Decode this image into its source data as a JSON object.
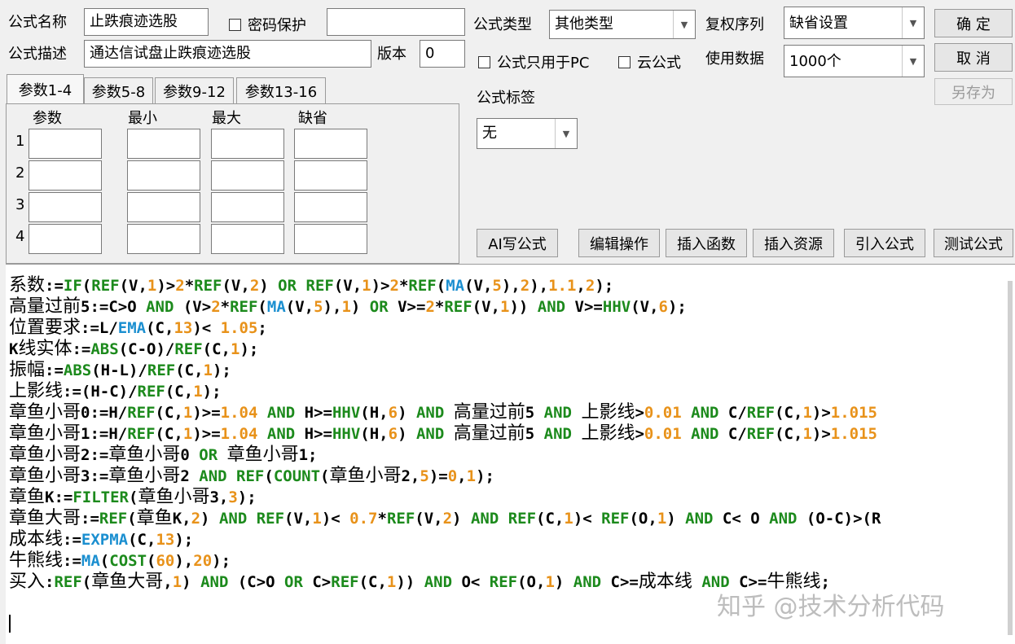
{
  "header": {
    "formula_name_label": "公式名称",
    "formula_name_value": "止跌痕迹选股",
    "password_label": "密码保护",
    "password_value": "",
    "formula_desc_label": "公式描述",
    "formula_desc_value": "通达信试盘止跌痕迹选股",
    "version_label": "版本",
    "version_value": "0",
    "formula_type_label": "公式类型",
    "formula_type_value": "其他类型",
    "adjust_label": "复权序列",
    "adjust_value": "缺省设置",
    "pc_only_label": "公式只用于PC",
    "cloud_label": "云公式",
    "data_label": "使用数据",
    "data_value": "1000个",
    "tag_label": "公式标签",
    "tag_value": "无"
  },
  "buttons": {
    "ok": "确  定",
    "cancel": "取  消",
    "save_as": "另存为",
    "ai_write": "AI写公式",
    "edit_ops": "编辑操作",
    "insert_func": "插入函数",
    "insert_res": "插入资源",
    "import_formula": "引入公式",
    "test_formula": "测试公式"
  },
  "tabs": [
    "参数1-4",
    "参数5-8",
    "参数9-12",
    "参数13-16"
  ],
  "params": {
    "headers": [
      "参数",
      "最小",
      "最大",
      "缺省"
    ],
    "rows": [
      "1",
      "2",
      "3",
      "4"
    ]
  },
  "code_lines": [
    [
      [
        "cn",
        "系数"
      ],
      [
        "op",
        ":="
      ],
      [
        "kw",
        "IF"
      ],
      [
        "op",
        "("
      ],
      [
        "kw",
        "REF"
      ],
      [
        "op",
        "(V,"
      ],
      [
        "num",
        "1"
      ],
      [
        "op",
        ")>"
      ],
      [
        "num",
        "2"
      ],
      [
        "op",
        "*"
      ],
      [
        "kw",
        "REF"
      ],
      [
        "op",
        "(V,"
      ],
      [
        "num",
        "2"
      ],
      [
        "op",
        ") "
      ],
      [
        "kw",
        "OR"
      ],
      [
        "op",
        " "
      ],
      [
        "kw",
        "REF"
      ],
      [
        "op",
        "(V,"
      ],
      [
        "num",
        "1"
      ],
      [
        "op",
        ")>"
      ],
      [
        "num",
        "2"
      ],
      [
        "op",
        "*"
      ],
      [
        "kw",
        "REF"
      ],
      [
        "op",
        "("
      ],
      [
        "blue",
        "MA"
      ],
      [
        "op",
        "(V,"
      ],
      [
        "num",
        "5"
      ],
      [
        "op",
        "),"
      ],
      [
        "num",
        "2"
      ],
      [
        "op",
        "),"
      ],
      [
        "num",
        "1.1"
      ],
      [
        "op",
        ","
      ],
      [
        "num",
        "2"
      ],
      [
        "op",
        ");"
      ]
    ],
    [
      [
        "cn",
        "高量过前"
      ],
      [
        "op",
        "5:=C>O "
      ],
      [
        "kw",
        "AND"
      ],
      [
        "op",
        " (V>"
      ],
      [
        "num",
        "2"
      ],
      [
        "op",
        "*"
      ],
      [
        "kw",
        "REF"
      ],
      [
        "op",
        "("
      ],
      [
        "blue",
        "MA"
      ],
      [
        "op",
        "(V,"
      ],
      [
        "num",
        "5"
      ],
      [
        "op",
        "),"
      ],
      [
        "num",
        "1"
      ],
      [
        "op",
        ") "
      ],
      [
        "kw",
        "OR"
      ],
      [
        "op",
        " V>="
      ],
      [
        "num",
        "2"
      ],
      [
        "op",
        "*"
      ],
      [
        "kw",
        "REF"
      ],
      [
        "op",
        "(V,"
      ],
      [
        "num",
        "1"
      ],
      [
        "op",
        ")) "
      ],
      [
        "kw",
        "AND"
      ],
      [
        "op",
        " V>="
      ],
      [
        "kw",
        "HHV"
      ],
      [
        "op",
        "(V,"
      ],
      [
        "num",
        "6"
      ],
      [
        "op",
        ");"
      ]
    ],
    [
      [
        "cn",
        "位置要求"
      ],
      [
        "op",
        ":=L/"
      ],
      [
        "blue",
        "EMA"
      ],
      [
        "op",
        "(C,"
      ],
      [
        "num",
        "13"
      ],
      [
        "op",
        ")< "
      ],
      [
        "num",
        "1.05"
      ],
      [
        "op",
        ";"
      ]
    ],
    [
      [
        "op",
        "K"
      ],
      [
        "cn",
        "线实体"
      ],
      [
        "op",
        ":="
      ],
      [
        "kw",
        "ABS"
      ],
      [
        "op",
        "(C-O)/"
      ],
      [
        "kw",
        "REF"
      ],
      [
        "op",
        "(C,"
      ],
      [
        "num",
        "1"
      ],
      [
        "op",
        ");"
      ]
    ],
    [
      [
        "cn",
        "振幅"
      ],
      [
        "op",
        ":="
      ],
      [
        "kw",
        "ABS"
      ],
      [
        "op",
        "(H-L)/"
      ],
      [
        "kw",
        "REF"
      ],
      [
        "op",
        "(C,"
      ],
      [
        "num",
        "1"
      ],
      [
        "op",
        ");"
      ]
    ],
    [
      [
        "cn",
        "上影线"
      ],
      [
        "op",
        ":=(H-C)/"
      ],
      [
        "kw",
        "REF"
      ],
      [
        "op",
        "(C,"
      ],
      [
        "num",
        "1"
      ],
      [
        "op",
        ");"
      ]
    ],
    [
      [
        "cn",
        "章鱼小哥"
      ],
      [
        "op",
        "0:=H/"
      ],
      [
        "kw",
        "REF"
      ],
      [
        "op",
        "(C,"
      ],
      [
        "num",
        "1"
      ],
      [
        "op",
        ")>="
      ],
      [
        "num",
        "1.04"
      ],
      [
        "op",
        " "
      ],
      [
        "kw",
        "AND"
      ],
      [
        "op",
        " H>="
      ],
      [
        "kw",
        "HHV"
      ],
      [
        "op",
        "(H,"
      ],
      [
        "num",
        "6"
      ],
      [
        "op",
        ") "
      ],
      [
        "kw",
        "AND"
      ],
      [
        "op",
        " "
      ],
      [
        "cn",
        "高量过前"
      ],
      [
        "op",
        "5 "
      ],
      [
        "kw",
        "AND"
      ],
      [
        "op",
        " "
      ],
      [
        "cn",
        "上影线"
      ],
      [
        "op",
        ">"
      ],
      [
        "num",
        "0.01"
      ],
      [
        "op",
        " "
      ],
      [
        "kw",
        "AND"
      ],
      [
        "op",
        " C/"
      ],
      [
        "kw",
        "REF"
      ],
      [
        "op",
        "(C,"
      ],
      [
        "num",
        "1"
      ],
      [
        "op",
        ")>"
      ],
      [
        "num",
        "1.015"
      ]
    ],
    [
      [
        "cn",
        "章鱼小哥"
      ],
      [
        "op",
        "1:=H/"
      ],
      [
        "kw",
        "REF"
      ],
      [
        "op",
        "(C,"
      ],
      [
        "num",
        "1"
      ],
      [
        "op",
        ")>="
      ],
      [
        "num",
        "1.04"
      ],
      [
        "op",
        " "
      ],
      [
        "kw",
        "AND"
      ],
      [
        "op",
        " H>="
      ],
      [
        "kw",
        "HHV"
      ],
      [
        "op",
        "(H,"
      ],
      [
        "num",
        "6"
      ],
      [
        "op",
        ") "
      ],
      [
        "kw",
        "AND"
      ],
      [
        "op",
        " "
      ],
      [
        "cn",
        "高量过前"
      ],
      [
        "op",
        "5 "
      ],
      [
        "kw",
        "AND"
      ],
      [
        "op",
        " "
      ],
      [
        "cn",
        "上影线"
      ],
      [
        "op",
        ">"
      ],
      [
        "num",
        "0.01"
      ],
      [
        "op",
        " "
      ],
      [
        "kw",
        "AND"
      ],
      [
        "op",
        " C/"
      ],
      [
        "kw",
        "REF"
      ],
      [
        "op",
        "(C,"
      ],
      [
        "num",
        "1"
      ],
      [
        "op",
        ")>"
      ],
      [
        "num",
        "1.015"
      ]
    ],
    [
      [
        "cn",
        "章鱼小哥"
      ],
      [
        "op",
        "2:="
      ],
      [
        "cn",
        "章鱼小哥"
      ],
      [
        "op",
        "0 "
      ],
      [
        "kw",
        "OR"
      ],
      [
        "op",
        " "
      ],
      [
        "cn",
        "章鱼小哥"
      ],
      [
        "op",
        "1;"
      ]
    ],
    [
      [
        "cn",
        "章鱼小哥"
      ],
      [
        "op",
        "3:="
      ],
      [
        "cn",
        "章鱼小哥"
      ],
      [
        "op",
        "2 "
      ],
      [
        "kw",
        "AND"
      ],
      [
        "op",
        " "
      ],
      [
        "kw",
        "REF"
      ],
      [
        "op",
        "("
      ],
      [
        "kw",
        "COUNT"
      ],
      [
        "op",
        "("
      ],
      [
        "cn",
        "章鱼小哥"
      ],
      [
        "op",
        "2,"
      ],
      [
        "num",
        "5"
      ],
      [
        "op",
        ")="
      ],
      [
        "num",
        "0"
      ],
      [
        "op",
        ","
      ],
      [
        "num",
        "1"
      ],
      [
        "op",
        ");"
      ]
    ],
    [
      [
        "cn",
        "章鱼"
      ],
      [
        "op",
        "K:="
      ],
      [
        "kw",
        "FILTER"
      ],
      [
        "op",
        "("
      ],
      [
        "cn",
        "章鱼小哥"
      ],
      [
        "op",
        "3,"
      ],
      [
        "num",
        "3"
      ],
      [
        "op",
        ");"
      ]
    ],
    [
      [
        "cn",
        "章鱼大哥"
      ],
      [
        "op",
        ":="
      ],
      [
        "kw",
        "REF"
      ],
      [
        "op",
        "("
      ],
      [
        "cn",
        "章鱼"
      ],
      [
        "op",
        "K,"
      ],
      [
        "num",
        "2"
      ],
      [
        "op",
        ") "
      ],
      [
        "kw",
        "AND"
      ],
      [
        "op",
        " "
      ],
      [
        "kw",
        "REF"
      ],
      [
        "op",
        "(V,"
      ],
      [
        "num",
        "1"
      ],
      [
        "op",
        ")< "
      ],
      [
        "num",
        "0.7"
      ],
      [
        "op",
        "*"
      ],
      [
        "kw",
        "REF"
      ],
      [
        "op",
        "(V,"
      ],
      [
        "num",
        "2"
      ],
      [
        "op",
        ") "
      ],
      [
        "kw",
        "AND"
      ],
      [
        "op",
        " "
      ],
      [
        "kw",
        "REF"
      ],
      [
        "op",
        "(C,"
      ],
      [
        "num",
        "1"
      ],
      [
        "op",
        ")< "
      ],
      [
        "kw",
        "REF"
      ],
      [
        "op",
        "(O,"
      ],
      [
        "num",
        "1"
      ],
      [
        "op",
        ") "
      ],
      [
        "kw",
        "AND"
      ],
      [
        "op",
        " C< O "
      ],
      [
        "kw",
        "AND"
      ],
      [
        "op",
        " (O-C)>(R"
      ]
    ],
    [
      [
        "cn",
        "成本线"
      ],
      [
        "op",
        ":="
      ],
      [
        "blue",
        "EXPMA"
      ],
      [
        "op",
        "(C,"
      ],
      [
        "num",
        "13"
      ],
      [
        "op",
        ");"
      ]
    ],
    [
      [
        "cn",
        "牛熊线"
      ],
      [
        "op",
        ":="
      ],
      [
        "blue",
        "MA"
      ],
      [
        "op",
        "("
      ],
      [
        "kw",
        "COST"
      ],
      [
        "op",
        "("
      ],
      [
        "num",
        "60"
      ],
      [
        "op",
        "),"
      ],
      [
        "num",
        "20"
      ],
      [
        "op",
        ");"
      ]
    ],
    [
      [
        "cn",
        "买入"
      ],
      [
        "op",
        ":"
      ],
      [
        "kw",
        "REF"
      ],
      [
        "op",
        "("
      ],
      [
        "cn",
        "章鱼大哥"
      ],
      [
        "op",
        ","
      ],
      [
        "num",
        "1"
      ],
      [
        "op",
        ") "
      ],
      [
        "kw",
        "AND"
      ],
      [
        "op",
        " (C>O "
      ],
      [
        "kw",
        "OR"
      ],
      [
        "op",
        " C>"
      ],
      [
        "kw",
        "REF"
      ],
      [
        "op",
        "(C,"
      ],
      [
        "num",
        "1"
      ],
      [
        "op",
        ")) "
      ],
      [
        "kw",
        "AND"
      ],
      [
        "op",
        " O< "
      ],
      [
        "kw",
        "REF"
      ],
      [
        "op",
        "(O,"
      ],
      [
        "num",
        "1"
      ],
      [
        "op",
        ") "
      ],
      [
        "kw",
        "AND"
      ],
      [
        "op",
        " C>="
      ],
      [
        "cn",
        "成本线"
      ],
      [
        "op",
        " "
      ],
      [
        "kw",
        "AND"
      ],
      [
        "op",
        " C>="
      ],
      [
        "cn",
        "牛熊线"
      ],
      [
        "op",
        ";"
      ]
    ]
  ],
  "watermark": "知乎 @技术分析代码"
}
